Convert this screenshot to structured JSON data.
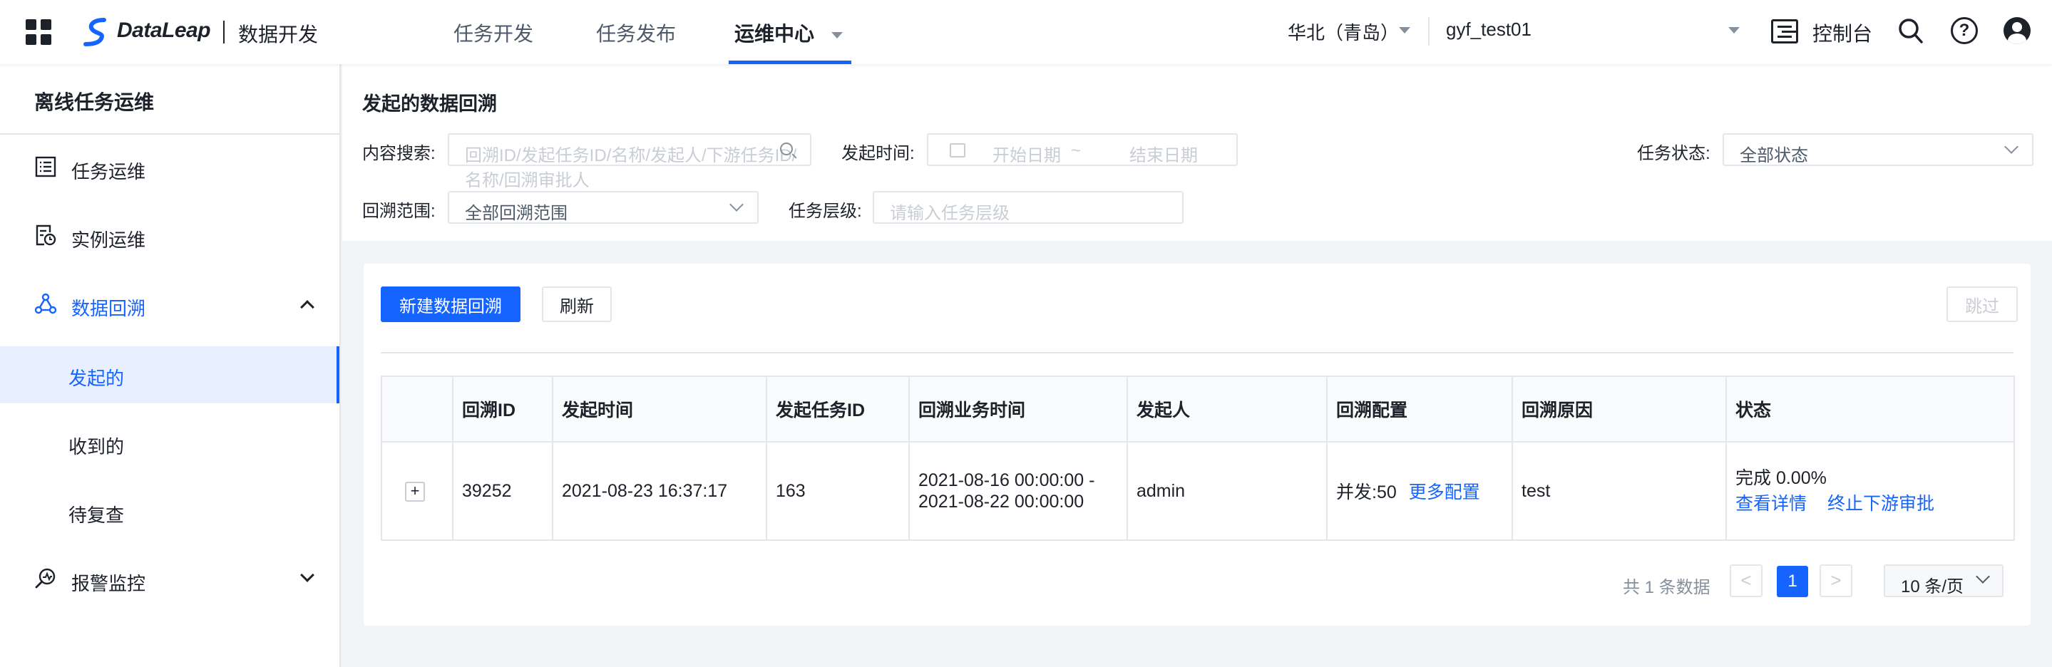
{
  "app": {
    "brand": "DataLeap",
    "module": "数据开发"
  },
  "nav": {
    "items": [
      "任务开发",
      "任务发布",
      "运维中心"
    ],
    "active": "运维中心"
  },
  "header": {
    "region": "华北（青岛）",
    "project": "gyf_test01",
    "console_label": "控制台",
    "help_glyph": "?"
  },
  "sidebar": {
    "title": "离线任务运维",
    "items": [
      {
        "label": "任务运维",
        "icon": "task-list-icon"
      },
      {
        "label": "实例运维",
        "icon": "instance-doc-icon"
      },
      {
        "label": "数据回溯",
        "icon": "share-nodes-icon",
        "expanded": true
      },
      {
        "label": "发起的",
        "selected": true
      },
      {
        "label": "收到的"
      },
      {
        "label": "待复查"
      },
      {
        "label": "报警监控",
        "icon": "alarm-icon",
        "expanded": false
      }
    ]
  },
  "filter": {
    "page_title": "发起的数据回溯",
    "search_label": "内容搜索:",
    "search_placeholder": "回溯ID/发起任务ID/名称/发起人/下游任务ID/名称/回溯审批人",
    "time_label": "发起时间:",
    "start_placeholder": "开始日期",
    "range_sep": "~",
    "end_placeholder": "结束日期",
    "status_label": "任务状态:",
    "status_value": "全部状态",
    "scope_label": "回溯范围:",
    "scope_value": "全部回溯范围",
    "level_label": "任务层级:",
    "level_placeholder": "请输入任务层级"
  },
  "toolbar": {
    "new_label": "新建数据回溯",
    "refresh_label": "刷新",
    "skip_label": "跳过"
  },
  "table": {
    "columns": [
      "",
      "回溯ID",
      "发起时间",
      "发起任务ID",
      "回溯业务时间",
      "发起人",
      "回溯配置",
      "回溯原因",
      "状态"
    ],
    "rows": [
      {
        "expand": "+",
        "id": "39252",
        "start_time": "2021-08-23 16:37:17",
        "task_id": "163",
        "biz_time_from": "2021-08-16 00:00:00 -",
        "biz_time_to": "2021-08-22 00:00:00",
        "initiator": "admin",
        "config": "并发:50",
        "config_link": "更多配置",
        "reason": "test",
        "status": "完成 0.00%",
        "action_view": "查看详情",
        "action_stop": "终止下游审批"
      }
    ]
  },
  "pagination": {
    "total_text": "共 1 条数据",
    "prev": "<",
    "current": "1",
    "next": ">",
    "page_size": "10 条/页"
  },
  "colors": {
    "accent": "#1664ff",
    "text": "#1d2129",
    "muted": "#86909c",
    "border": "#e5e6eb",
    "background": "#f2f3f5"
  }
}
